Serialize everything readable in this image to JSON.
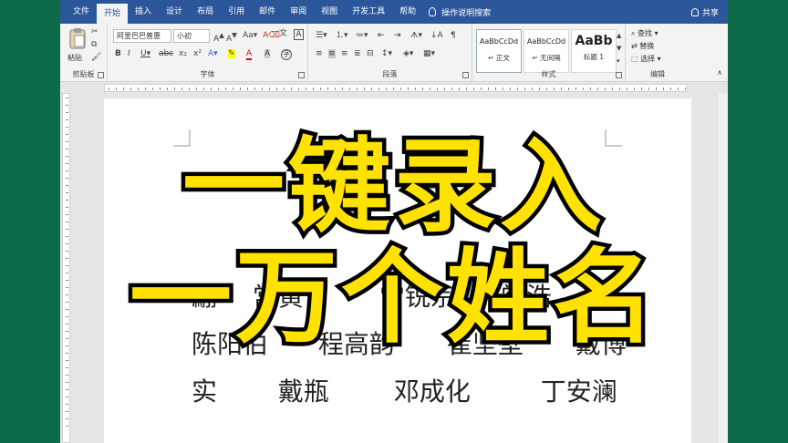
{
  "ribbon_tabs": [
    "文件",
    "开始",
    "插入",
    "设计",
    "布局",
    "引用",
    "邮件",
    "审阅",
    "视图",
    "开发工具",
    "帮助"
  ],
  "active_tab": "开始",
  "tell_me": "操作说明搜索",
  "share": "共享",
  "clipboard": {
    "paste": "粘贴",
    "label": "剪贴板"
  },
  "font": {
    "name": "阿里巴巴普惠",
    "size": "小初",
    "label": "字体"
  },
  "paragraph": {
    "label": "段落"
  },
  "styles": {
    "label": "样式",
    "items": [
      {
        "sample": "AaBbCcDd",
        "name": "↵ 正文"
      },
      {
        "sample": "AaBbCcDd",
        "name": "↵ 无间隔"
      },
      {
        "sample": "AaBb",
        "name": "标题 1"
      }
    ]
  },
  "editing": {
    "find": "查找",
    "replace": "替换",
    "select": "选择",
    "label": "编辑"
  },
  "document": {
    "heading_partial": "姓名",
    "rows": [
      [
        "翩",
        "常黄吉",
        "常锐宗",
        "常浩"
      ],
      [
        "陈阳伯",
        "程高韵",
        "崔坚壁",
        "戴博"
      ],
      [
        "实",
        "戴瓶",
        "邓成化",
        "丁安澜"
      ]
    ]
  },
  "overlay": {
    "line1": "一键录入",
    "line2": "一万个姓名",
    "color": "#ffe200"
  },
  "colors": {
    "ribbon_blue": "#2b579a",
    "background_green": "#0e6b4a"
  }
}
